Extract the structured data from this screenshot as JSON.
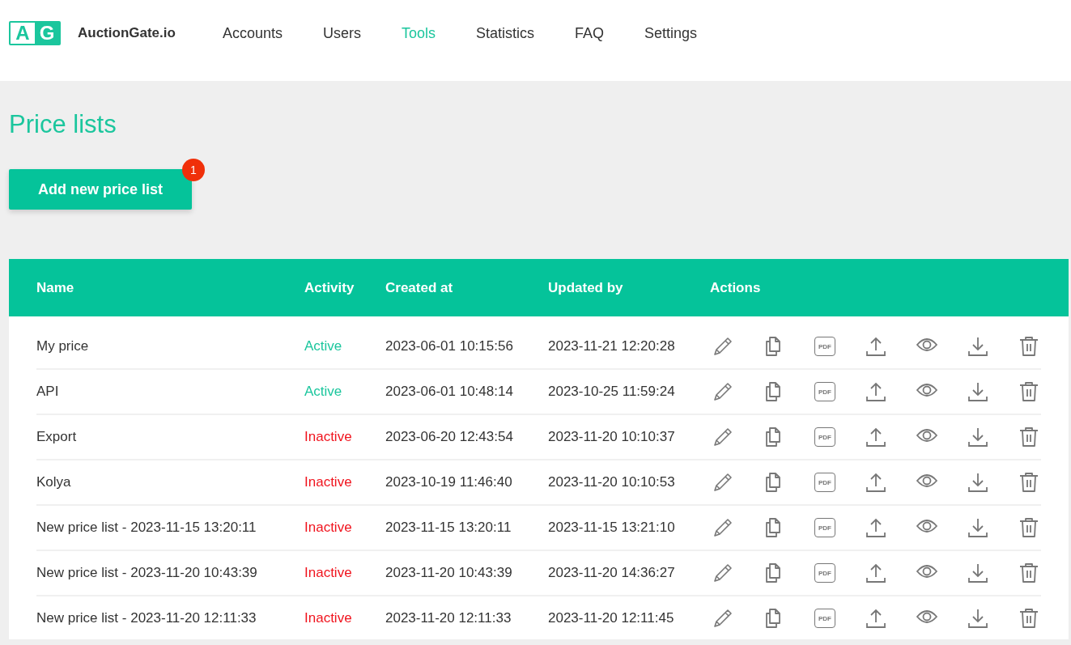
{
  "header": {
    "logo_letters": [
      "A",
      "G"
    ],
    "brand": "AuctionGate.io",
    "nav": [
      {
        "label": "Accounts",
        "selected": false
      },
      {
        "label": "Users",
        "selected": false
      },
      {
        "label": "Tools",
        "selected": true
      },
      {
        "label": "Statistics",
        "selected": false
      },
      {
        "label": "FAQ",
        "selected": false
      },
      {
        "label": "Settings",
        "selected": false
      }
    ]
  },
  "page_title": "Price lists",
  "add_button": {
    "label": "Add new price list",
    "badge": "1"
  },
  "table": {
    "columns": [
      "Name",
      "Activity",
      "Created at",
      "Updated by",
      "Actions"
    ],
    "rows": [
      {
        "name": "My price",
        "activity": "Active",
        "active": true,
        "created_at": "2023-06-01 10:15:56",
        "updated_by": "2023-11-21 12:20:28",
        "pdf_label": "PDF"
      },
      {
        "name": "API",
        "activity": "Active",
        "active": true,
        "created_at": "2023-06-01 10:48:14",
        "updated_by": "2023-10-25 11:59:24",
        "pdf_label": "PDF"
      },
      {
        "name": "Export",
        "activity": "Inactive",
        "active": false,
        "created_at": "2023-06-20 12:43:54",
        "updated_by": "2023-11-20 10:10:37",
        "pdf_label": "PDF"
      },
      {
        "name": "Kolya",
        "activity": "Inactive",
        "active": false,
        "created_at": "2023-10-19 11:46:40",
        "updated_by": "2023-11-20 10:10:53",
        "pdf_label": "PDF"
      },
      {
        "name": "New price list - 2023-11-15 13:20:11",
        "activity": "Inactive",
        "active": false,
        "created_at": "2023-11-15 13:20:11",
        "updated_by": "2023-11-15 13:21:10",
        "pdf_label": "PDF"
      },
      {
        "name": "New price list - 2023-11-20 10:43:39",
        "activity": "Inactive",
        "active": false,
        "created_at": "2023-11-20 10:43:39",
        "updated_by": "2023-11-20 14:36:27",
        "pdf_label": "PDF"
      },
      {
        "name": "New price list - 2023-11-20 12:11:33",
        "activity": "Inactive",
        "active": false,
        "created_at": "2023-11-20 12:11:33",
        "updated_by": "2023-11-20 12:11:45",
        "pdf_label": "PDF"
      }
    ]
  }
}
